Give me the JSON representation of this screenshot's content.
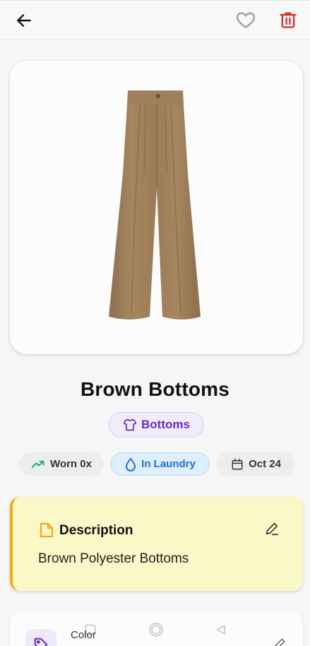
{
  "item": {
    "title": "Brown Bottoms",
    "category": "Bottoms"
  },
  "stats": {
    "worn": "Worn 0x",
    "status": "In Laundry",
    "date": "Oct 24"
  },
  "description": {
    "heading": "Description",
    "text": "Brown Polyester Bottoms"
  },
  "color_section": {
    "label": "Color"
  },
  "icons": {
    "back": "arrow-left-icon",
    "favorite": "heart-outline-icon",
    "delete": "trash-icon",
    "category": "shirt-icon",
    "worn": "trending-up-icon",
    "laundry": "droplet-icon",
    "date": "calendar-icon",
    "description": "file-icon",
    "edit": "pencil-icon",
    "color": "tag-icon"
  },
  "colors": {
    "accent_purple": "#6a2bc7",
    "laundry_blue": "#1e6fd1",
    "worn_green": "#17a673",
    "delete_red": "#d32f2f",
    "description_bg": "#fbf8c8",
    "description_accent": "#f2a81d",
    "garment_brown": "#a6865f"
  }
}
